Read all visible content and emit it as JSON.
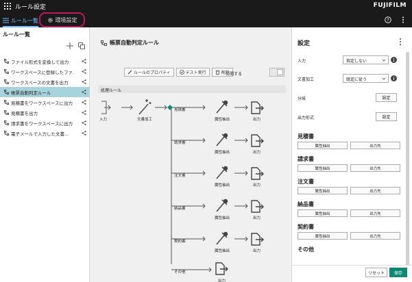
{
  "app": {
    "title": "ルール設定",
    "brand": "FUJIFILM"
  },
  "tabs": {
    "rules": "ルール一覧",
    "env": "環境設定"
  },
  "left": {
    "title": "ルール一覧",
    "items": [
      {
        "label": "ファイル形式を変換して出力",
        "selected": false
      },
      {
        "label": "ワークスペースに登録したファ...",
        "selected": false
      },
      {
        "label": "ワークスペースの文書を出力",
        "selected": false
      },
      {
        "label": "帳票自動判定ルール",
        "selected": true
      },
      {
        "label": "見積書をワークスペースに出力",
        "selected": false
      },
      {
        "label": "見積書を出力",
        "selected": false
      },
      {
        "label": "請求書をワークスペースに出力",
        "selected": false
      },
      {
        "label": "電子メールで入力した文書...",
        "selected": false
      }
    ]
  },
  "center": {
    "rule_title": "帳票自動判定ルール",
    "toolbar": {
      "props": "ルールのプロパティ",
      "test": "テスト実行",
      "delete": "削除",
      "publish": "公開する"
    },
    "flow_label": "処理ルール",
    "flow": {
      "input": "入力",
      "doc_process": "文書加工",
      "branches": [
        "見積書",
        "請求書",
        "注文書",
        "納品書",
        "契約書",
        "その他"
      ],
      "extract": "属性抽出",
      "output": "出力"
    }
  },
  "right": {
    "title": "設定",
    "fields": [
      {
        "label": "入力",
        "value": "指定しない"
      },
      {
        "label": "文書加工",
        "value": "既定に従う"
      }
    ],
    "set_label": "設定",
    "set_rows": [
      "分岐",
      "出力形式"
    ],
    "sections": [
      "見積書",
      "請求書",
      "注文書",
      "納品書",
      "契約書",
      "その他"
    ],
    "extract_btn": "属性抽出",
    "output_btn": "出力先",
    "reset": "リセット",
    "save": "保存"
  },
  "colors": {
    "accent": "#0a8a72",
    "selected": "#a7d4dc",
    "tab_active": "#6fc2ff",
    "highlight_ring": "#c2185b"
  }
}
